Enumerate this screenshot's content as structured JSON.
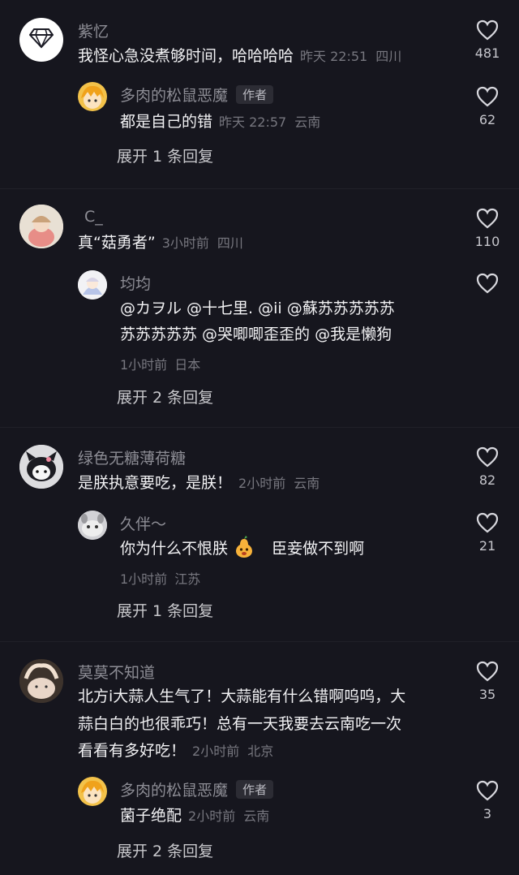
{
  "expand_icon": "chevron-down-icon",
  "threads": [
    {
      "comment": {
        "name": "紫忆",
        "text": "我怪心急没煮够时间，哈哈哈哈",
        "time": "昨天 22:51",
        "location": "四川",
        "likes": "481",
        "avatar_icon": "diamond-icon"
      },
      "replies": [
        {
          "name": "多肉的松鼠恶魔",
          "badge": "作者",
          "text": "都是自己的错",
          "time": "昨天 22:57",
          "location": "云南",
          "likes": "62"
        }
      ],
      "expand": "展开 1 条回复"
    },
    {
      "comment": {
        "name": "C_",
        "text": "真“菇勇者”",
        "time": "3小时前",
        "location": "四川",
        "likes": "110"
      },
      "replies": [
        {
          "name": "均均",
          "text_line1": "@カヲル @十七里. @ii @蘇苏苏苏苏苏",
          "text_line2": "苏苏苏苏苏 @哭唧唧歪歪的 @我是懒狗",
          "time": "1小时前",
          "location": "日本",
          "likes": ""
        }
      ],
      "expand": "展开 2 条回复"
    },
    {
      "comment": {
        "name": "绿色无糖薄荷糖",
        "text": "是朕执意要吃，是朕！",
        "time": "2小时前",
        "location": "云南",
        "likes": "82"
      },
      "replies": [
        {
          "name": "久伴～",
          "text_a": "你为什么不恨朕",
          "text_b": "臣妾做不到啊",
          "emoji_icon": "pear-emoji-icon",
          "time": "1小时前",
          "location": "江苏",
          "likes": "21"
        }
      ],
      "expand": "展开 1 条回复"
    },
    {
      "comment": {
        "name": "莫莫不知道",
        "text_line1": "北方i大蒜人生气了！大蒜能有什么错啊呜呜，大",
        "text_line2": "蒜白白的也很乖巧！总有一天我要去云南吃一次",
        "text_line3": "看看有多好吃！",
        "time": "2小时前",
        "location": "北京",
        "likes": "35"
      },
      "replies": [
        {
          "name": "多肉的松鼠恶魔",
          "badge": "作者",
          "text": "菌子绝配",
          "time": "2小时前",
          "location": "云南",
          "likes": "3"
        }
      ],
      "expand": "展开 2 条回复"
    }
  ]
}
